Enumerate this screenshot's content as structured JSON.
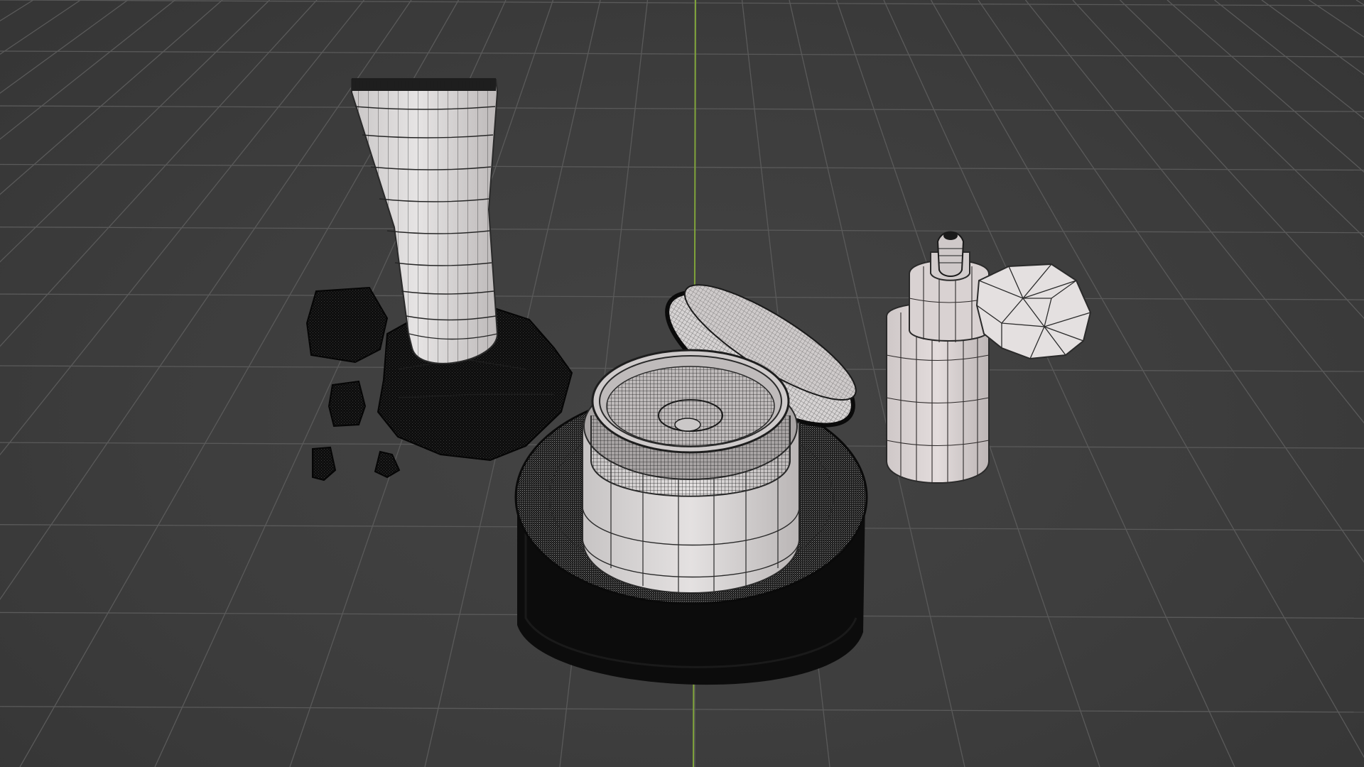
{
  "viewport": {
    "background": "#3d3d3d",
    "grid_color": "#5a5a5a",
    "y_axis_color": "#7fa33a",
    "wire_color": "#1a1a1a",
    "mesh_light": "#d9d6d6",
    "mesh_dark": "#0f0f0f"
  },
  "objects": [
    {
      "name": "squeeze-tube",
      "shade": "light"
    },
    {
      "name": "rock-stand",
      "shade": "dark"
    },
    {
      "name": "rock-chunks",
      "shade": "dark"
    },
    {
      "name": "cream-jar",
      "shade": "light"
    },
    {
      "name": "jar-lid",
      "shade": "light"
    },
    {
      "name": "wooden-pedestal",
      "shade": "dark"
    },
    {
      "name": "dropper-bottle",
      "shade": "light"
    },
    {
      "name": "gem-stone",
      "shade": "light"
    }
  ]
}
